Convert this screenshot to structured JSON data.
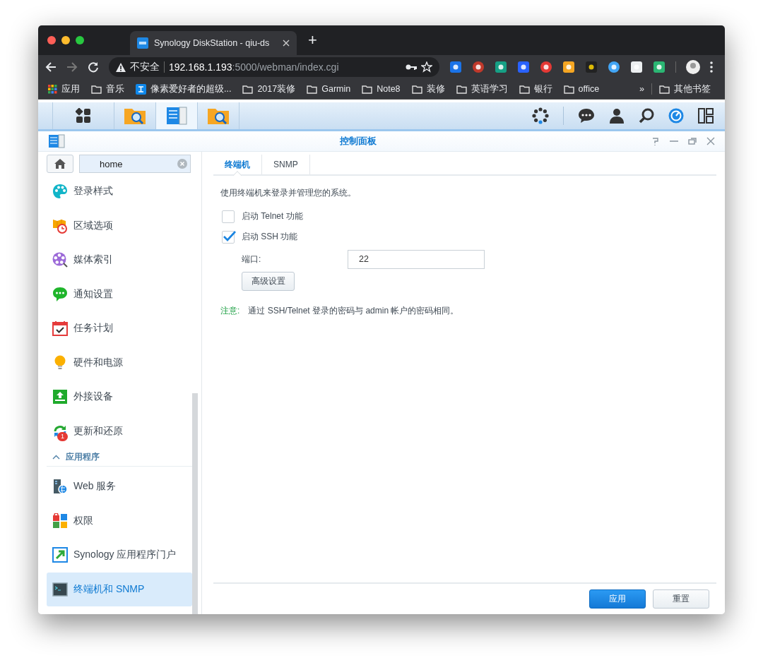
{
  "browser": {
    "tab_title": "Synology DiskStation - qiu-ds",
    "new_tab": "+",
    "security": "不安全",
    "url_host": "192.168.1.193",
    "url_rest": ":5000/webman/index.cgi"
  },
  "bookmarks": [
    {
      "label": "应用",
      "kind": "apps"
    },
    {
      "label": "音乐",
      "kind": "folder"
    },
    {
      "label": "像素爱好者的超级...",
      "kind": "site"
    },
    {
      "label": "2017装修",
      "kind": "folder"
    },
    {
      "label": "Garmin",
      "kind": "folder"
    },
    {
      "label": "Note8",
      "kind": "folder"
    },
    {
      "label": "装修",
      "kind": "folder"
    },
    {
      "label": "英语学习",
      "kind": "folder"
    },
    {
      "label": "银行",
      "kind": "folder"
    },
    {
      "label": "office",
      "kind": "folder"
    }
  ],
  "bookmarks_more": "»",
  "other_bookmarks": "其他书签",
  "window": {
    "title": "控制面板"
  },
  "sidebar": {
    "search": "home",
    "items": [
      {
        "label": "登录样式",
        "kind": "palette",
        "selected": false
      },
      {
        "label": "区域选项",
        "kind": "region",
        "selected": false
      },
      {
        "label": "媒体索引",
        "kind": "media",
        "selected": false
      },
      {
        "label": "通知设置",
        "kind": "chat",
        "selected": false
      },
      {
        "label": "任务计划",
        "kind": "calendar",
        "selected": false
      },
      {
        "label": "硬件和电源",
        "kind": "bulb",
        "selected": false
      },
      {
        "label": "外接设备",
        "kind": "upload",
        "selected": false
      },
      {
        "label": "更新和还原",
        "kind": "update",
        "badge": "1",
        "selected": false
      }
    ],
    "section": {
      "label": "应用程序",
      "expanded": true,
      "items": [
        {
          "label": "Web 服务",
          "kind": "server",
          "selected": false
        },
        {
          "label": "权限",
          "kind": "blocks",
          "selected": false
        },
        {
          "label": "Synology 应用程序门户",
          "kind": "portal",
          "selected": false
        },
        {
          "label": "终端机和 SNMP",
          "kind": "terminal",
          "selected": true
        }
      ]
    }
  },
  "tabs": [
    {
      "label": "终端机",
      "selected": true
    },
    {
      "label": "SNMP",
      "selected": false
    }
  ],
  "description": "使用终端机来登录并管理您的系统。",
  "options": [
    {
      "label": "启动 Telnet 功能",
      "checked": false
    },
    {
      "label": "启动 SSH 功能",
      "checked": true
    }
  ],
  "port": {
    "label": "端口:",
    "value": "22"
  },
  "advanced_button": "高级设置",
  "note": {
    "label": "注意:",
    "text": "通过 SSH/Telnet 登录的密码与 admin 帐户的密码相同。"
  },
  "buttons": [
    {
      "label": "应用",
      "kind": "primary"
    },
    {
      "label": "重置",
      "kind": "secondary"
    }
  ]
}
